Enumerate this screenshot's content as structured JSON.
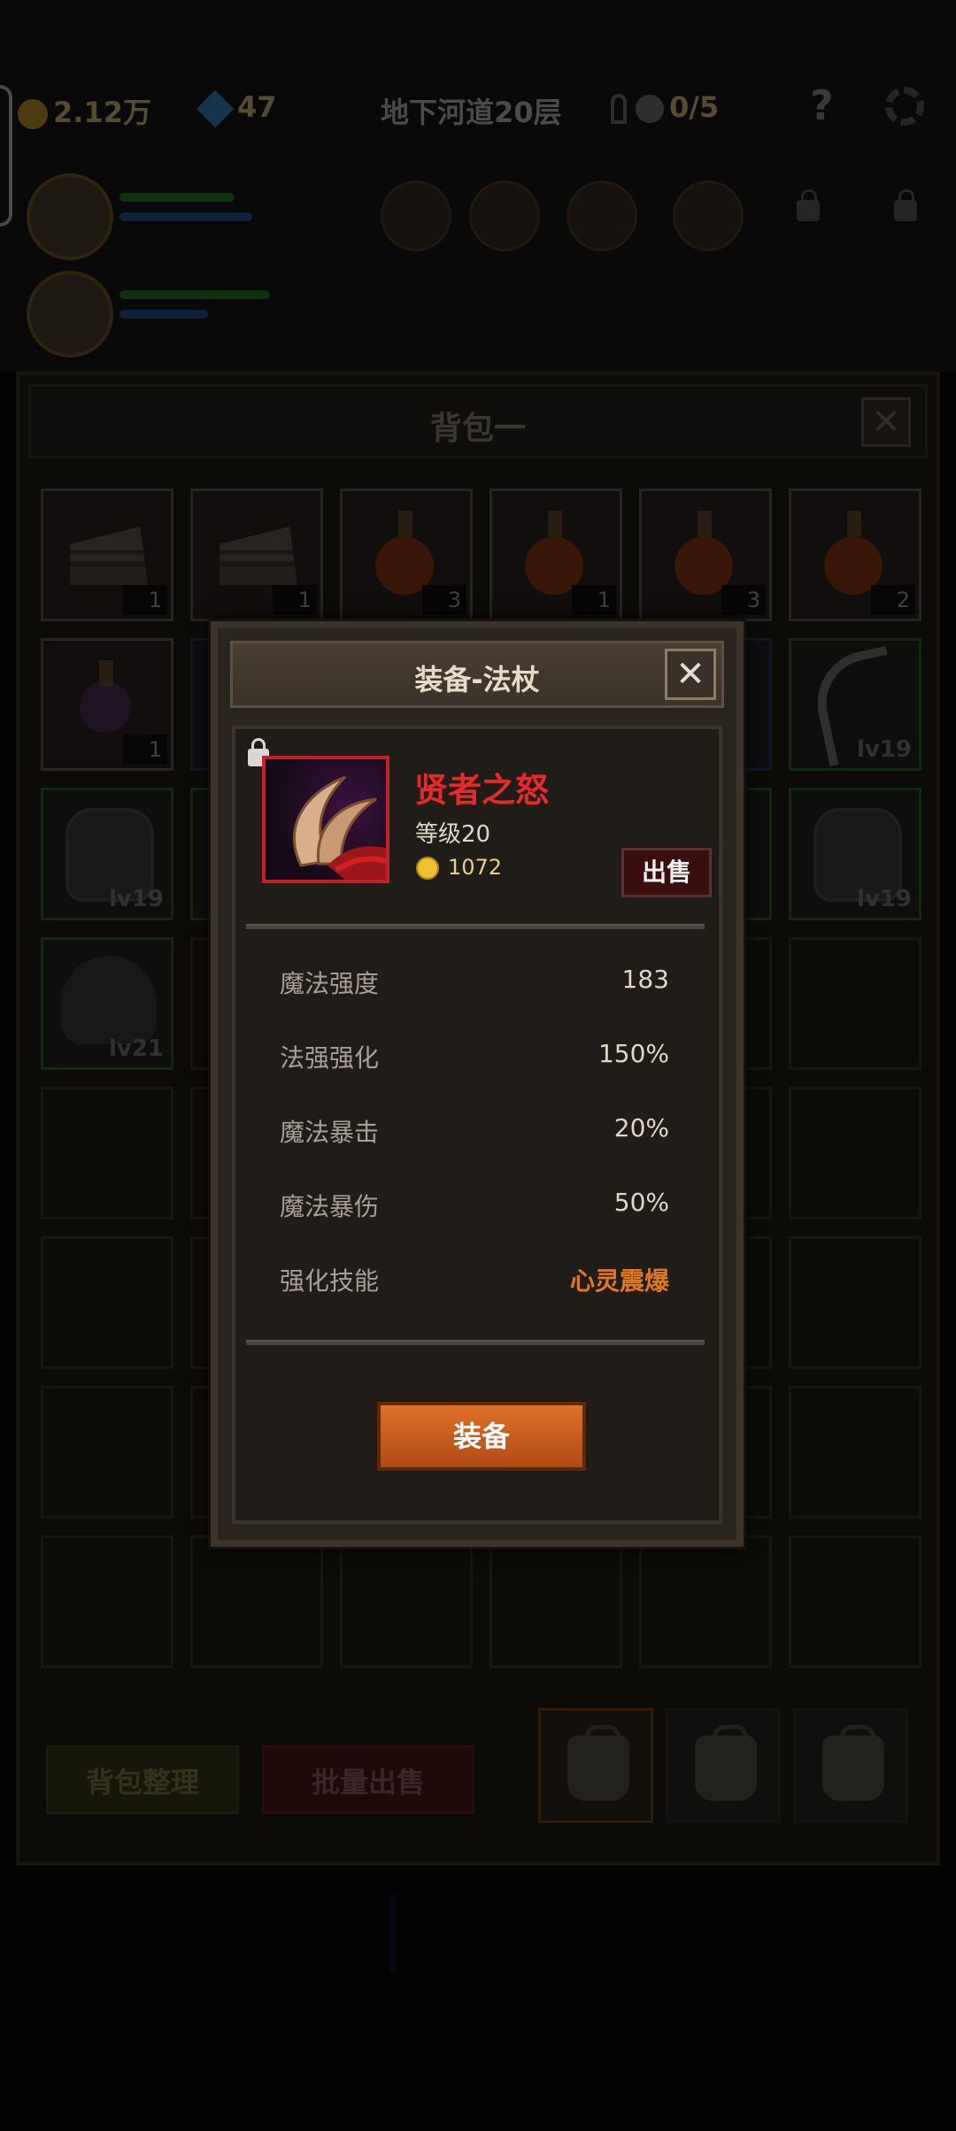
{
  "hud": {
    "gold": "2.12万",
    "gems": "47",
    "stage": "地下河道20层",
    "skull_count": "0/5",
    "help": "?"
  },
  "bag": {
    "title": "背包一",
    "close": "✕",
    "row1": [
      {
        "kind": "cake",
        "count": "1"
      },
      {
        "kind": "cake",
        "count": "1"
      },
      {
        "kind": "potion",
        "count": "3"
      },
      {
        "kind": "potion",
        "count": "1"
      },
      {
        "kind": "potion",
        "count": "3"
      },
      {
        "kind": "potion",
        "count": "2"
      }
    ],
    "row2_first_count": "1",
    "row2_last_level": "lv19",
    "row3_first_level": "lv19",
    "row3_last_level": "lv19",
    "row4_first_level": "lv21",
    "sort_button": "背包整理",
    "bulk_sell_button": "批量出售"
  },
  "modal": {
    "title": "装备-法杖",
    "close": "✕",
    "item_name": "贤者之怒",
    "item_level": "等级20",
    "price": "1072",
    "sell_button": "出售",
    "stats": [
      {
        "label": "魔法强度",
        "value": "183"
      },
      {
        "label": "法强强化",
        "value": "150%"
      },
      {
        "label": "魔法暴击",
        "value": "20%"
      },
      {
        "label": "魔法暴伤",
        "value": "50%"
      },
      {
        "label": "强化技能",
        "value": "心灵震爆"
      }
    ],
    "equip_button": "装备",
    "colors": {
      "item_name": "#e62a2a",
      "skill": "#e07820",
      "equip_button": "#d0622a",
      "frame_border": "#c4202a"
    }
  }
}
